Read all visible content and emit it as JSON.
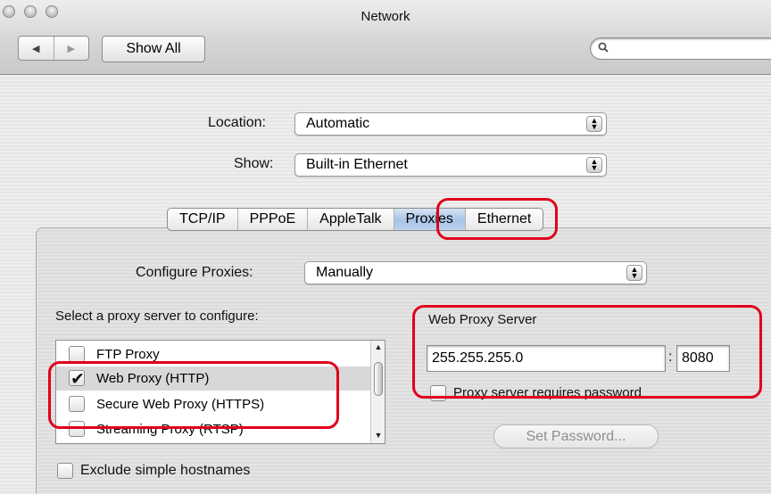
{
  "window": {
    "title": "Network",
    "show_all_label": "Show All",
    "search": {
      "value": "",
      "placeholder": ""
    }
  },
  "location": {
    "label": "Location:",
    "value": "Automatic"
  },
  "show": {
    "label": "Show:",
    "value": "Built-in Ethernet"
  },
  "tabs": [
    "TCP/IP",
    "PPPoE",
    "AppleTalk",
    "Proxies",
    "Ethernet"
  ],
  "selected_tab": "Proxies",
  "configure": {
    "label": "Configure Proxies:",
    "value": "Manually"
  },
  "proxy_list": {
    "heading": "Select a proxy server to configure:",
    "items": [
      {
        "label": "FTP Proxy",
        "checked": false
      },
      {
        "label": "Web Proxy (HTTP)",
        "checked": true
      },
      {
        "label": "Secure Web Proxy (HTTPS)",
        "checked": false
      },
      {
        "label": "Streaming Proxy (RTSP)",
        "checked": false
      }
    ]
  },
  "web_proxy_server": {
    "heading": "Web Proxy Server",
    "address": "255.255.255.0",
    "separator": ":",
    "port": "8080",
    "requires_password_label": "Proxy server requires password",
    "set_password_label": "Set Password..."
  },
  "exclude_simple_hostnames_label": "Exclude simple hostnames",
  "colors": {
    "highlight_box": "#e0001b",
    "selected_tab": "#a8c4e6"
  }
}
